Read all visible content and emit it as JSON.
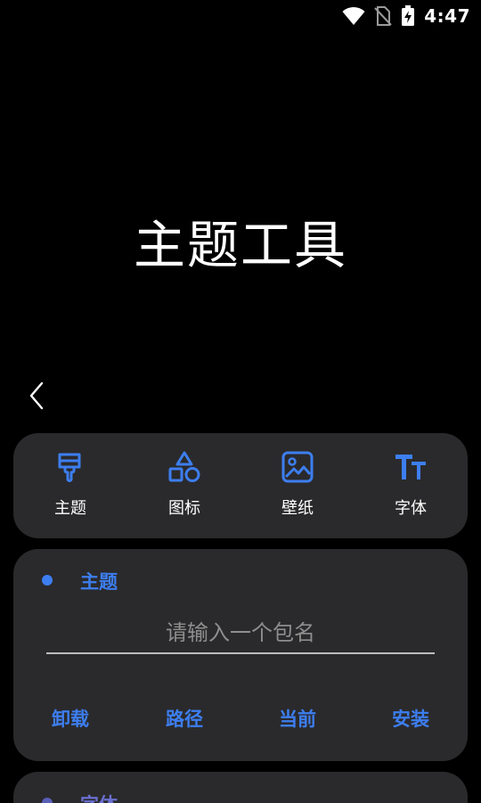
{
  "status_bar": {
    "time": "4:47",
    "icons": [
      "wifi-icon",
      "no-sim-icon",
      "battery-charging-icon"
    ]
  },
  "page": {
    "title": "主题工具"
  },
  "tabs": [
    {
      "label": "主题",
      "icon": "paint-brush-icon"
    },
    {
      "label": "图标",
      "icon": "shapes-icon"
    },
    {
      "label": "壁纸",
      "icon": "image-icon"
    },
    {
      "label": "字体",
      "icon": "font-size-icon"
    }
  ],
  "theme_section": {
    "title": "主题",
    "input": {
      "placeholder": "请输入一个包名",
      "value": ""
    },
    "actions": [
      "卸载",
      "路径",
      "当前",
      "安装"
    ]
  },
  "font_section": {
    "title": "字体"
  },
  "colors": {
    "accent": "#3d7ef0",
    "card_bg": "#2a2a2c",
    "background": "#000000"
  }
}
